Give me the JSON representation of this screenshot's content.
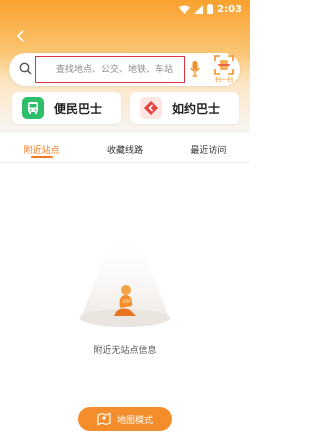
{
  "status_bar": {
    "time": "2:03"
  },
  "search": {
    "placeholder": "查找地点、公交、地铁、车站"
  },
  "scan": {
    "label": "扫一扫"
  },
  "cards": [
    {
      "label": "便民巴士"
    },
    {
      "label": "如约巴士"
    }
  ],
  "tabs": [
    {
      "label": "附近站点",
      "active": true
    },
    {
      "label": "收藏线路",
      "active": false
    },
    {
      "label": "最近访问",
      "active": false
    }
  ],
  "empty_state": {
    "message": "附近无站点信息"
  },
  "map_button": {
    "label": "地图模式"
  },
  "colors": {
    "accent": "#f3781e",
    "button": "#f48e2c",
    "bus_icon": "#2fbf6a",
    "appt_icon": "#e8423c",
    "highlight_border": "#d9343f"
  }
}
